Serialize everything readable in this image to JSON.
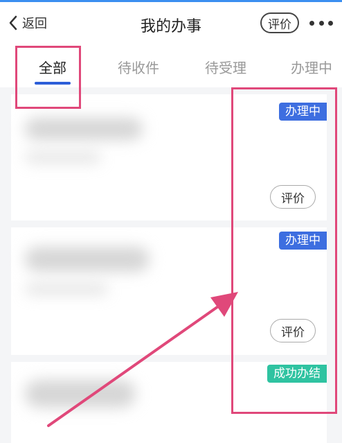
{
  "header": {
    "back_label": "返回",
    "title": "我的办事",
    "rate_label": "评价"
  },
  "tabs": [
    {
      "label": "全部",
      "active": true
    },
    {
      "label": "待收件",
      "active": false
    },
    {
      "label": "待受理",
      "active": false
    },
    {
      "label": "办理中",
      "active": false
    }
  ],
  "items": [
    {
      "status": "办理中",
      "status_color": "#3d6ee0",
      "action_label": "评价"
    },
    {
      "status": "办理中",
      "status_color": "#3d6ee0",
      "action_label": "评价"
    },
    {
      "status": "成功办结",
      "status_color": "#2fc3a1"
    }
  ],
  "annotation": {
    "highlight_color": "#e0487a"
  }
}
